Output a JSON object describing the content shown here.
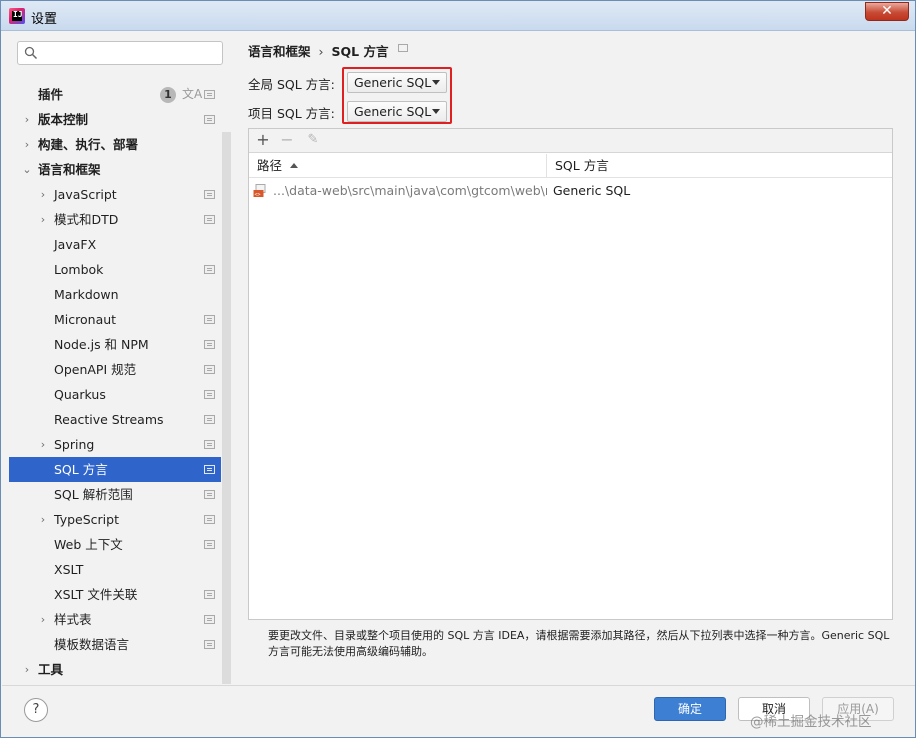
{
  "window": {
    "title": "设置",
    "close_glyph": "✕"
  },
  "search": {
    "placeholder": ""
  },
  "sidebar": {
    "items": [
      {
        "label": "插件",
        "level": 0,
        "bold": true,
        "arrow": "",
        "badge": "1",
        "translate": "文A",
        "proj": true,
        "selected": false
      },
      {
        "label": "版本控制",
        "level": 0,
        "bold": true,
        "arrow": "›",
        "proj": true,
        "selected": false
      },
      {
        "label": "构建、执行、部署",
        "level": 0,
        "bold": true,
        "arrow": "›",
        "proj": false,
        "selected": false
      },
      {
        "label": "语言和框架",
        "level": 0,
        "bold": true,
        "arrow": "⌄",
        "proj": false,
        "selected": false
      },
      {
        "label": "JavaScript",
        "level": 1,
        "bold": false,
        "arrow": "›",
        "proj": true,
        "selected": false
      },
      {
        "label": "模式和DTD",
        "level": 1,
        "bold": false,
        "arrow": "›",
        "proj": true,
        "selected": false
      },
      {
        "label": "JavaFX",
        "level": 1,
        "bold": false,
        "arrow": "",
        "proj": false,
        "selected": false
      },
      {
        "label": "Lombok",
        "level": 1,
        "bold": false,
        "arrow": "",
        "proj": true,
        "selected": false
      },
      {
        "label": "Markdown",
        "level": 1,
        "bold": false,
        "arrow": "",
        "proj": false,
        "selected": false
      },
      {
        "label": "Micronaut",
        "level": 1,
        "bold": false,
        "arrow": "",
        "proj": true,
        "selected": false
      },
      {
        "label": "Node.js 和 NPM",
        "level": 1,
        "bold": false,
        "arrow": "",
        "proj": true,
        "selected": false
      },
      {
        "label": "OpenAPI 规范",
        "level": 1,
        "bold": false,
        "arrow": "",
        "proj": true,
        "selected": false
      },
      {
        "label": "Quarkus",
        "level": 1,
        "bold": false,
        "arrow": "",
        "proj": true,
        "selected": false
      },
      {
        "label": "Reactive Streams",
        "level": 1,
        "bold": false,
        "arrow": "",
        "proj": true,
        "selected": false
      },
      {
        "label": "Spring",
        "level": 1,
        "bold": false,
        "arrow": "›",
        "proj": true,
        "selected": false
      },
      {
        "label": "SQL 方言",
        "level": 1,
        "bold": false,
        "arrow": "",
        "proj": true,
        "selected": true
      },
      {
        "label": "SQL 解析范围",
        "level": 1,
        "bold": false,
        "arrow": "",
        "proj": true,
        "selected": false
      },
      {
        "label": "TypeScript",
        "level": 1,
        "bold": false,
        "arrow": "›",
        "proj": true,
        "selected": false
      },
      {
        "label": "Web 上下文",
        "level": 1,
        "bold": false,
        "arrow": "",
        "proj": true,
        "selected": false
      },
      {
        "label": "XSLT",
        "level": 1,
        "bold": false,
        "arrow": "",
        "proj": false,
        "selected": false
      },
      {
        "label": "XSLT 文件关联",
        "level": 1,
        "bold": false,
        "arrow": "",
        "proj": true,
        "selected": false
      },
      {
        "label": "样式表",
        "level": 1,
        "bold": false,
        "arrow": "›",
        "proj": true,
        "selected": false
      },
      {
        "label": "模板数据语言",
        "level": 1,
        "bold": false,
        "arrow": "",
        "proj": true,
        "selected": false
      },
      {
        "label": "工具",
        "level": 0,
        "bold": true,
        "arrow": "›",
        "proj": false,
        "selected": false
      }
    ]
  },
  "breadcrumb": {
    "parent": "语言和框架",
    "separator": "›",
    "current": "SQL 方言"
  },
  "global_dialect": {
    "label": "全局 SQL 方言:",
    "value": "Generic SQL"
  },
  "project_dialect": {
    "label": "项目 SQL 方言:",
    "value": "Generic SQL"
  },
  "table": {
    "toolbar": {
      "add": "+",
      "remove": "−",
      "edit": "✎"
    },
    "columns": [
      "路径",
      "SQL 方言"
    ],
    "rows": [
      {
        "path": "...\\data-web\\src\\main\\java\\com\\gtcom\\web\\mapper",
        "dialect": "Generic SQL"
      }
    ]
  },
  "note": "要更改文件、目录或整个项目使用的 SQL 方言 IDEA，请根据需要添加其路径，然后从下拉列表中选择一种方言。Generic SQL 方言可能无法使用高级编码辅助。",
  "footer": {
    "help": "?",
    "ok": "确定",
    "cancel": "取消",
    "apply": "应用(A)",
    "watermark": "@稀土掘金技术社区"
  },
  "colors": {
    "selection": "#2f65ca",
    "ok_button": "#3d7fd3",
    "highlight_border": "#e02020"
  }
}
